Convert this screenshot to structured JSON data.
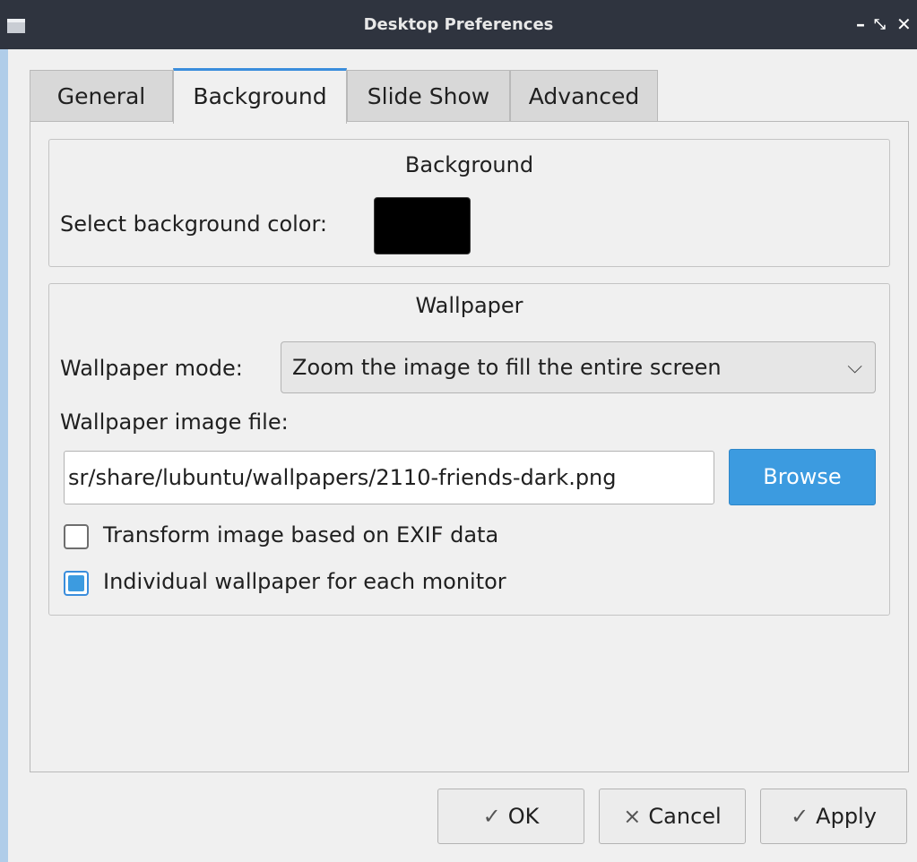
{
  "window": {
    "title": "Desktop Preferences",
    "controls": {
      "minimize": "–",
      "maximize": "⤡",
      "close": "✕"
    }
  },
  "tabs": [
    {
      "label": "General",
      "active": false
    },
    {
      "label": "Background",
      "active": true
    },
    {
      "label": "Slide Show",
      "active": false
    },
    {
      "label": "Advanced",
      "active": false
    }
  ],
  "background_group": {
    "title": "Background",
    "color_label": "Select background color:",
    "color_value": "#000000"
  },
  "wallpaper_group": {
    "title": "Wallpaper",
    "mode_label": "Wallpaper mode:",
    "mode_value": "Zoom the image to fill the entire screen",
    "file_label": "Wallpaper image file:",
    "file_value": "sr/share/lubuntu/wallpapers/2110-friends-dark.png",
    "browse_label": "Browse",
    "exif_label": "Transform image based on EXIF data",
    "exif_checked": false,
    "individual_label": "Individual wallpaper for each monitor",
    "individual_checked": true
  },
  "buttons": {
    "ok_icon": "✓",
    "ok_label": "OK",
    "cancel_icon": "×",
    "cancel_label": "Cancel",
    "apply_icon": "✓",
    "apply_label": "Apply"
  },
  "colors": {
    "accent": "#3c9be0",
    "titlebar": "#2f343f"
  }
}
